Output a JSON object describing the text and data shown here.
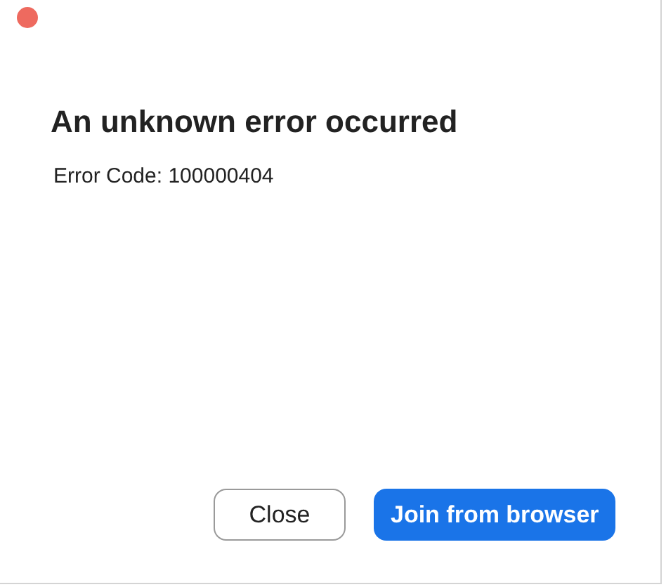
{
  "dialog": {
    "title": "An unknown error occurred",
    "message": "Error Code: 100000404"
  },
  "buttons": [
    {
      "label": "Close",
      "kind": "secondary"
    },
    {
      "label": "Join from browser",
      "kind": "primary"
    }
  ]
}
